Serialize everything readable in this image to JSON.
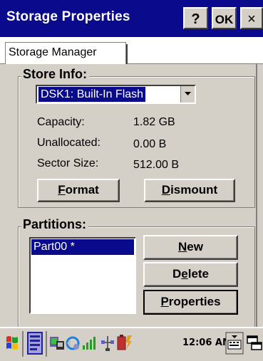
{
  "window": {
    "title": "Storage Properties",
    "help_label": "?",
    "ok_label": "OK",
    "close_label": "×"
  },
  "tabs": [
    {
      "label": "Storage Manager",
      "active": true
    }
  ],
  "store_info": {
    "group_label": "Store Info:",
    "store_select": {
      "value": "DSK1: Built-In Flash"
    },
    "rows": [
      {
        "label": "Capacity:",
        "value": "1.82 GB"
      },
      {
        "label": "Unallocated:",
        "value": "0.00 B"
      },
      {
        "label": "Sector Size:",
        "value": "512.00 B"
      }
    ],
    "format_button": {
      "mnemonic": "F",
      "rest": "ormat"
    },
    "dismount_button": {
      "mnemonic": "D",
      "rest": "ismount"
    }
  },
  "partitions": {
    "group_label": "Partitions:",
    "items": [
      {
        "label": "Part00 *",
        "selected": true
      }
    ],
    "new_button": {
      "mnemonic": "N",
      "rest": "ew"
    },
    "delete_button": {
      "prefix": "D",
      "mnemonic": "e",
      "rest": "lete"
    },
    "properties_button": {
      "mnemonic": "P",
      "rest": "roperties"
    }
  },
  "taskbar": {
    "clock": "12:06 AM",
    "icons": [
      "start-flag-icon",
      "notes-icon",
      "connection-icon",
      "sync-icon",
      "signal-icon",
      "usb-icon",
      "battery-icon",
      "keyboard-icon",
      "desktop-icon"
    ]
  },
  "colors": {
    "titlebar": "#0a0a8c",
    "selection": "#0a0a8c",
    "face": "#d4d0c8"
  }
}
